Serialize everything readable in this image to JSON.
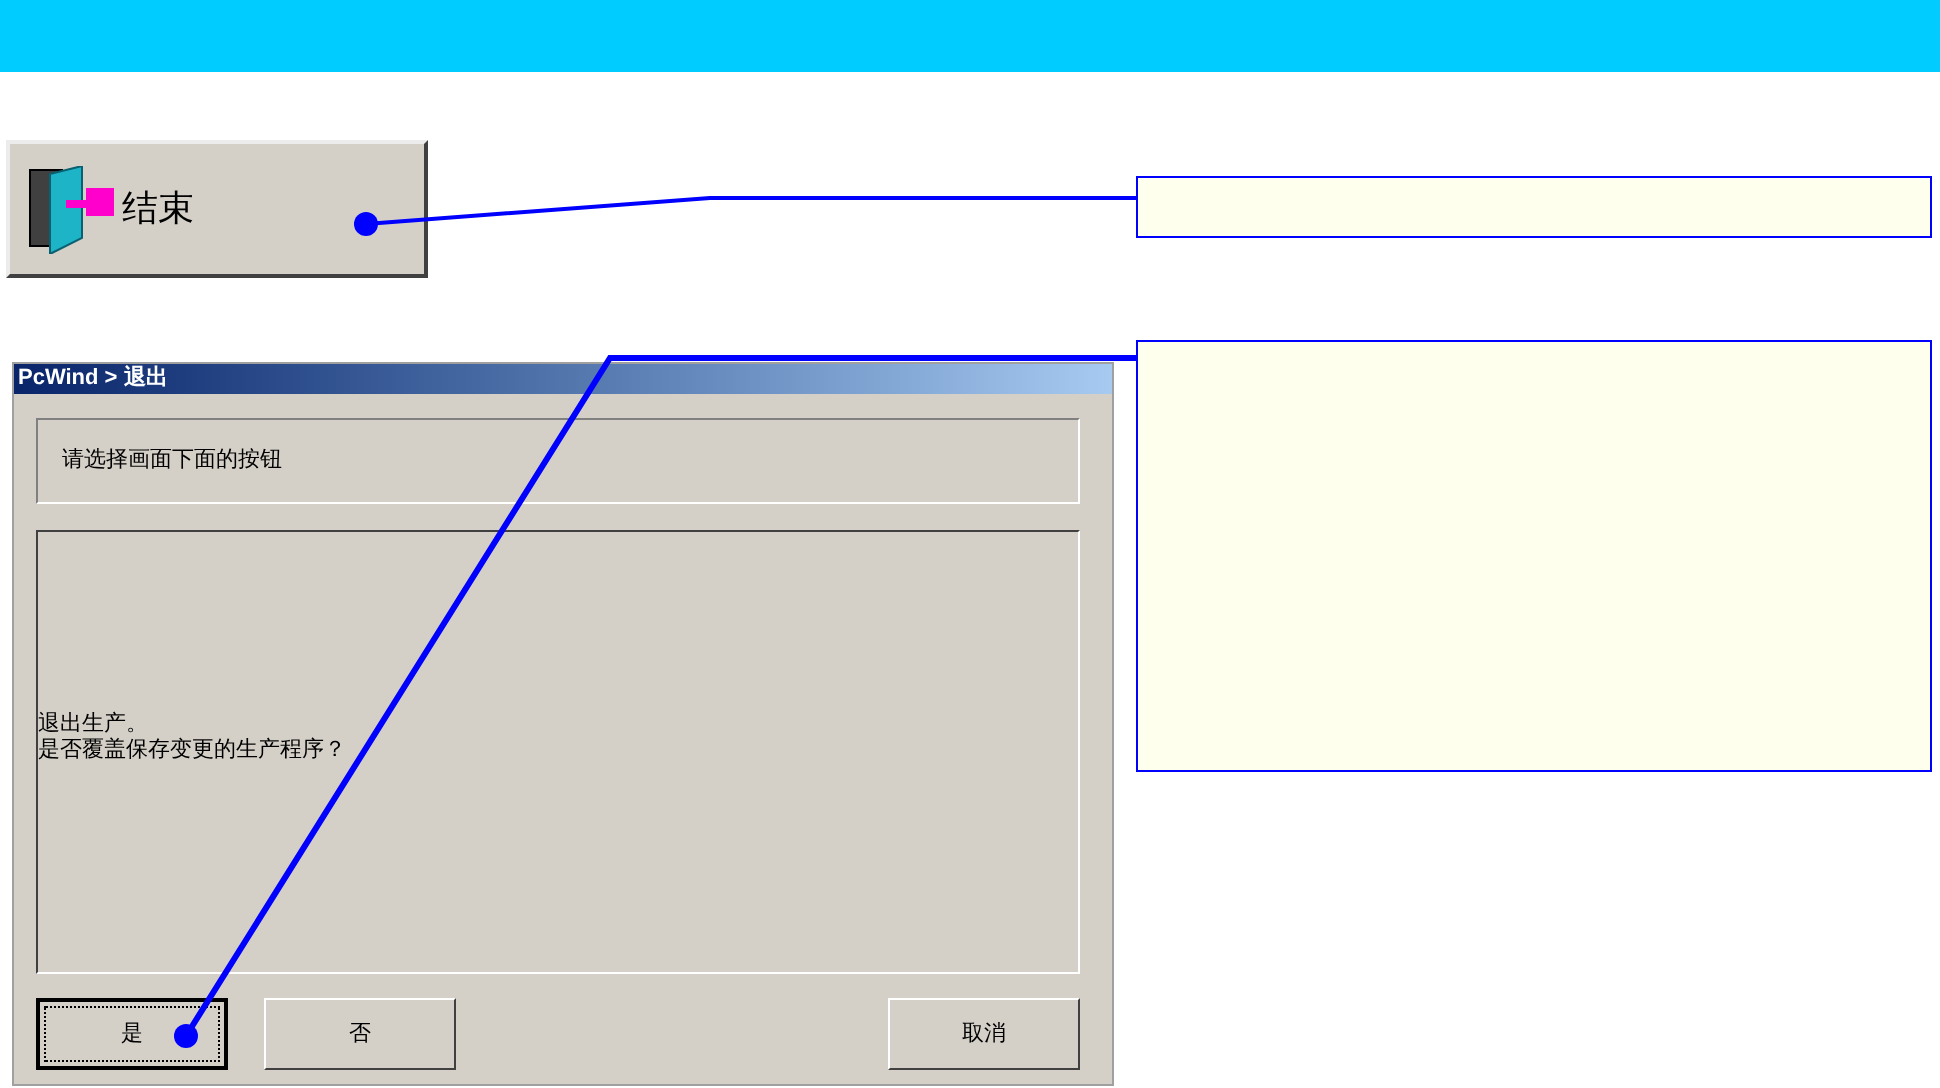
{
  "exit_button": {
    "label": "结束"
  },
  "callouts": [
    {
      "kind": "note"
    },
    {
      "kind": "note"
    }
  ],
  "dialog": {
    "title": "PcWind > 退出",
    "prompt": "请选择画面下面的按钮",
    "message": [
      "退出生产。",
      "是否覆盖保存变更的生产程序？"
    ],
    "buttons": [
      {
        "label": "是",
        "focused": true
      },
      {
        "label": "否",
        "focused": false
      },
      {
        "label": "取消",
        "focused": false
      }
    ]
  }
}
